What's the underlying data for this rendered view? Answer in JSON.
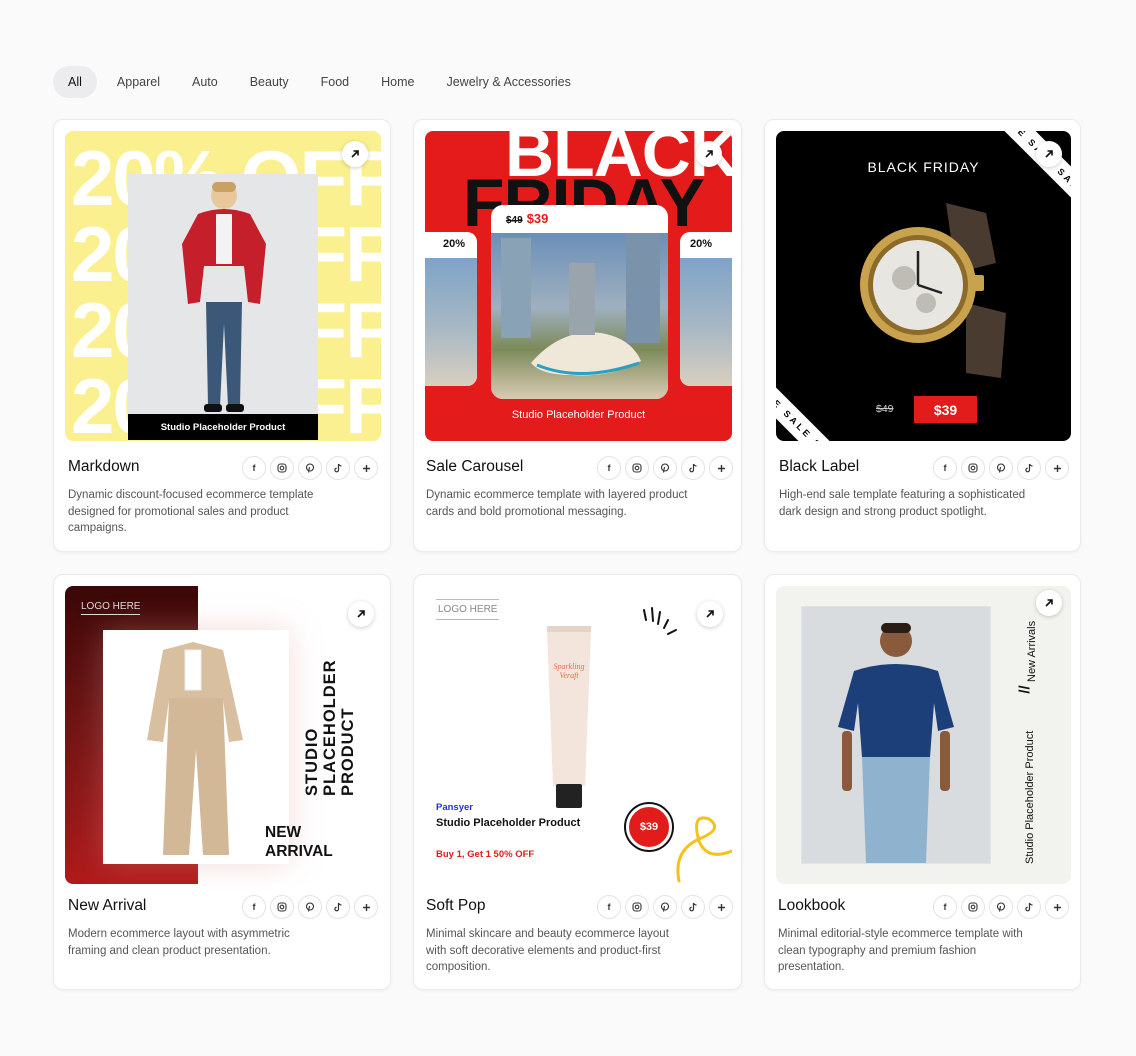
{
  "filters": [
    "All",
    "Apparel",
    "Auto",
    "Beauty",
    "Food",
    "Home",
    "Jewelry & Accessories"
  ],
  "active_filter": "All",
  "cards": [
    {
      "title": "Markdown",
      "description": "Dynamic discount-focused ecommerce template designed for promotional sales and product campaigns.",
      "preview": {
        "repeat_text": "20% OFF",
        "product_label": "Studio Placeholder Product",
        "bg_color": "#fbf08f"
      }
    },
    {
      "title": "Sale Carousel",
      "description": "Dynamic ecommerce template with layered product cards and bold promotional messaging.",
      "preview": {
        "headline_1": "BLACK",
        "headline_2": "FRIDAY",
        "old_price": "$49",
        "price": "$39",
        "side_badge": "20%",
        "product_label": "Studio Placeholder Product",
        "bg_color": "#e31b1b"
      }
    },
    {
      "title": "Black Label",
      "description": "High-end sale template featuring a sophisticated dark design and strong product spotlight.",
      "preview": {
        "headline": "BLACK FRIDAY",
        "old_price": "$49",
        "price": "$39",
        "ribbon_text": "SALE SALE SALE SALE"
      }
    },
    {
      "title": "New Arrival",
      "description": "Modern ecommerce layout with asymmetric framing and clean product presentation.",
      "preview": {
        "logo": "LOGO HERE",
        "vertical_text": [
          "STUDIO",
          "PLACEHOLDER",
          "PRODUCT"
        ],
        "badge_text": [
          "NEW",
          "ARRIVAL"
        ]
      }
    },
    {
      "title": "Soft Pop",
      "description": "Minimal skincare and beauty ecommerce layout with soft decorative elements and product-first composition.",
      "preview": {
        "logo": "LOGO HERE",
        "brand": "Pansyer",
        "product_label": "Studio Placeholder Product",
        "offer": "Buy 1, Get 1 50% OFF",
        "price": "$39",
        "tube_text": "Sparkling Veraft"
      }
    },
    {
      "title": "Lookbook",
      "description": "Minimal editorial-style ecommerce template with clean typography and premium fashion presentation.",
      "preview": {
        "vertical_right": "New Arrivals",
        "separator": "//",
        "vertical_left": "Studio Placeholder Product"
      }
    }
  ],
  "social_icons": [
    "facebook-icon",
    "instagram-icon",
    "pinterest-icon",
    "tiktok-icon",
    "plus-icon"
  ]
}
